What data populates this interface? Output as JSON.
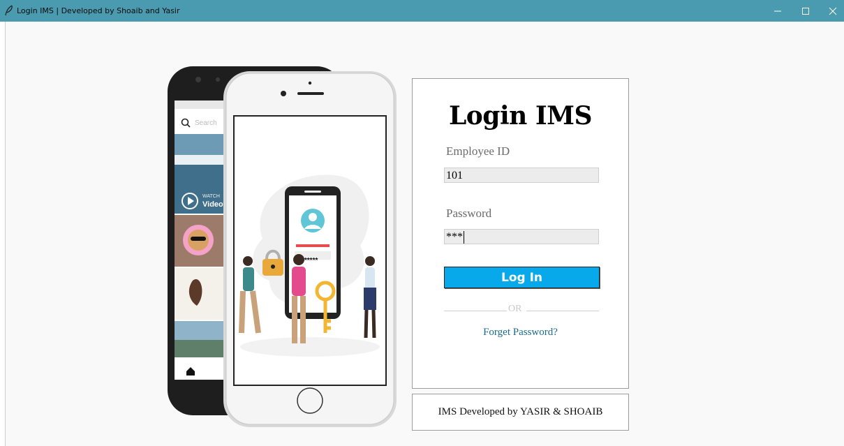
{
  "window": {
    "title": "Login IMS | Developed by Shoaib and Yasir"
  },
  "illustration": {
    "search_placeholder": "Search",
    "watch_label": "WATCH",
    "video_label": "Video",
    "password_mask": "******"
  },
  "login": {
    "heading": "Login IMS",
    "employee_id_label": "Employee ID",
    "employee_id_value": "101",
    "password_label": "Password",
    "password_value": "***",
    "login_button": "Log In",
    "or_text": "OR",
    "forgot_link": "Forget Password?"
  },
  "footer": {
    "text": "IMS Developed by YASIR & SHOAIB"
  },
  "colors": {
    "titlebar": "#4a9bb0",
    "login_button": "#08a9ea",
    "link": "#1a6b8a"
  }
}
